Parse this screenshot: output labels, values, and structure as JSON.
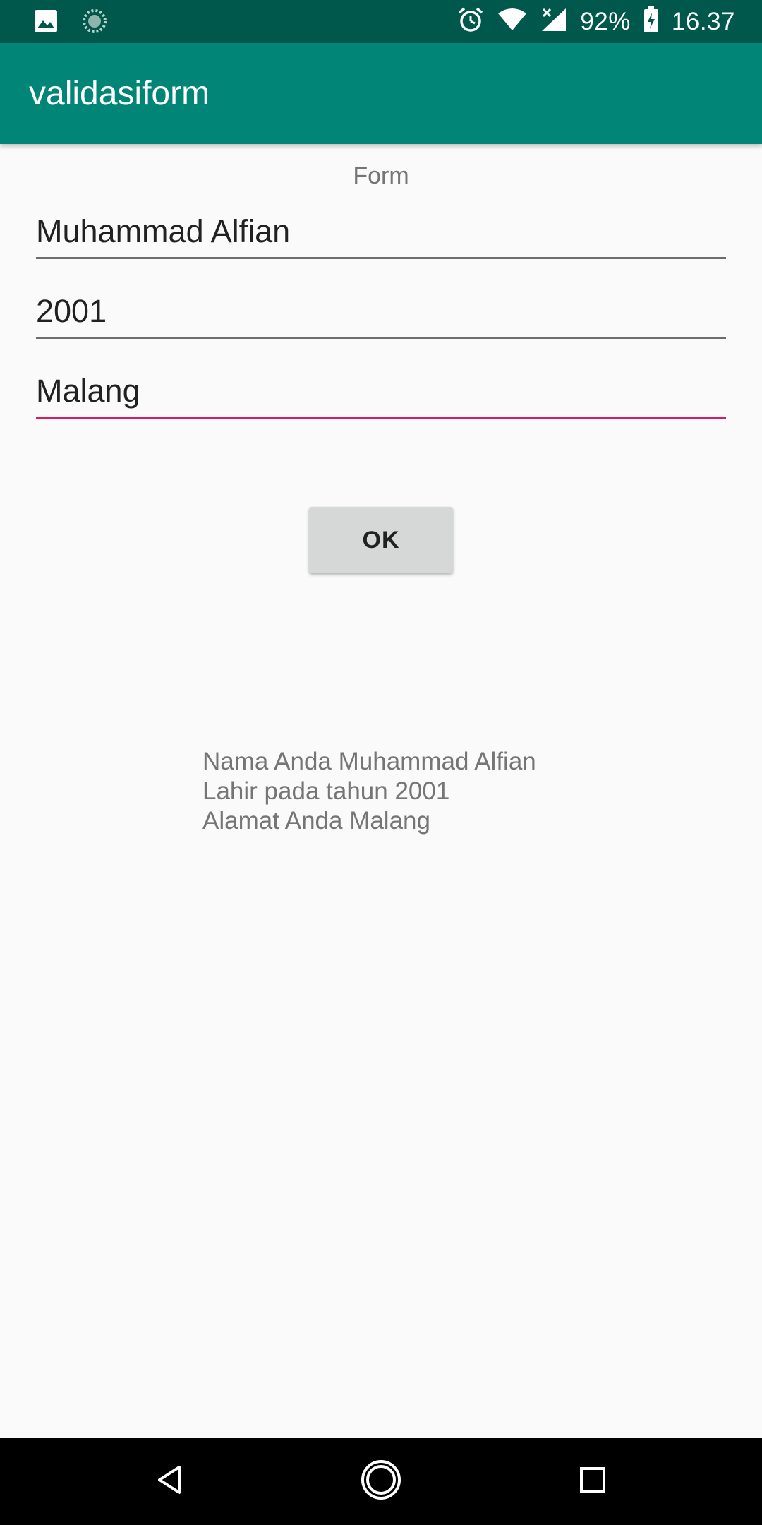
{
  "status_bar": {
    "battery": "92%",
    "time": "16.37",
    "icons": [
      "image-icon",
      "loading-icon",
      "alarm-icon",
      "wifi-icon",
      "signal-icon",
      "battery-icon"
    ]
  },
  "app_bar": {
    "title": "validasiform"
  },
  "form": {
    "label": "Form",
    "name_value": "Muhammad Alfian",
    "year_value": "2001",
    "address_value": "Malang",
    "ok_label": "OK"
  },
  "output": {
    "line1": "Nama Anda Muhammad Alfian",
    "line2": "Lahir pada tahun 2001",
    "line3": "Alamat Anda Malang"
  },
  "colors": {
    "status_bar": "#00574b",
    "app_bar": "#008577",
    "accent": "#d81b60",
    "background": "#fafafa"
  },
  "nav_bar": {
    "icons": [
      "back-icon",
      "home-icon",
      "recent-apps-icon"
    ]
  }
}
